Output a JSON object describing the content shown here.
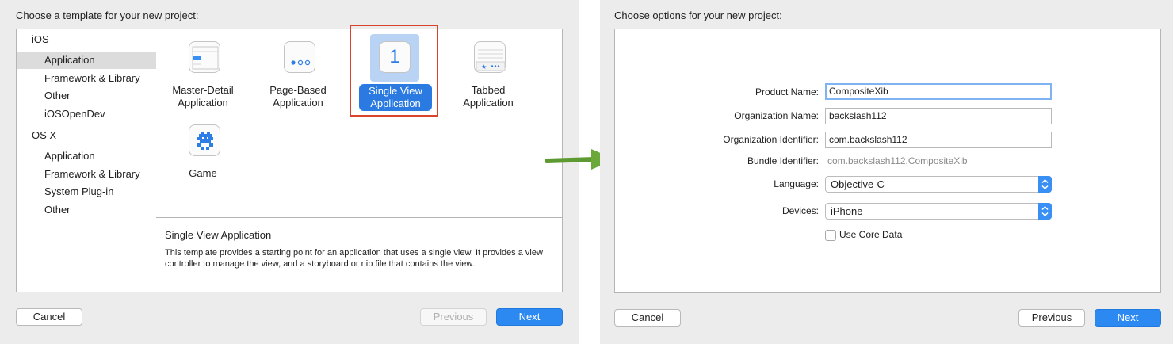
{
  "left": {
    "heading": "Choose a template for your new project:",
    "sidebar": {
      "items": [
        {
          "label": "iOS"
        },
        {
          "label": "Application"
        },
        {
          "label": "Framework & Library"
        },
        {
          "label": "Other"
        },
        {
          "label": "iOSOpenDev"
        },
        {
          "label": "OS X"
        },
        {
          "label": "Application"
        },
        {
          "label": "Framework & Library"
        },
        {
          "label": "System Plug-in"
        },
        {
          "label": "Other"
        }
      ]
    },
    "templates": [
      {
        "label": "Master-Detail\nApplication",
        "icon": "master-detail-icon"
      },
      {
        "label": "Page-Based\nApplication",
        "icon": "page-based-icon"
      },
      {
        "label": "Single View\nApplication",
        "icon": "single-view-icon",
        "icon_text": "1"
      },
      {
        "label": "Tabbed\nApplication",
        "icon": "tabbed-icon"
      },
      {
        "label": "Game",
        "icon": "game-icon"
      }
    ],
    "description": {
      "title": "Single View Application",
      "text": "This template provides a starting point for an application that uses a single view. It provides a view controller to manage the view, and a storyboard or nib file that contains the view."
    },
    "buttons": {
      "cancel": "Cancel",
      "previous": "Previous",
      "next": "Next"
    }
  },
  "right": {
    "heading": "Choose options for your new project:",
    "form": {
      "product_name_label": "Product Name:",
      "product_name_value": "CompositeXib",
      "org_name_label": "Organization Name:",
      "org_name_value": "backslash112",
      "org_id_label": "Organization Identifier:",
      "org_id_value": "com.backslash112",
      "bundle_id_label": "Bundle Identifier:",
      "bundle_id_value": "com.backslash112.CompositeXib",
      "language_label": "Language:",
      "language_value": "Objective-C",
      "devices_label": "Devices:",
      "devices_value": "iPhone",
      "core_data_label": "Use Core Data"
    },
    "buttons": {
      "cancel": "Cancel",
      "previous": "Previous",
      "next": "Next"
    }
  },
  "colors": {
    "accent": "#2c89f2",
    "highlight_box": "#d9432c",
    "arrow": "#6aa83a"
  }
}
